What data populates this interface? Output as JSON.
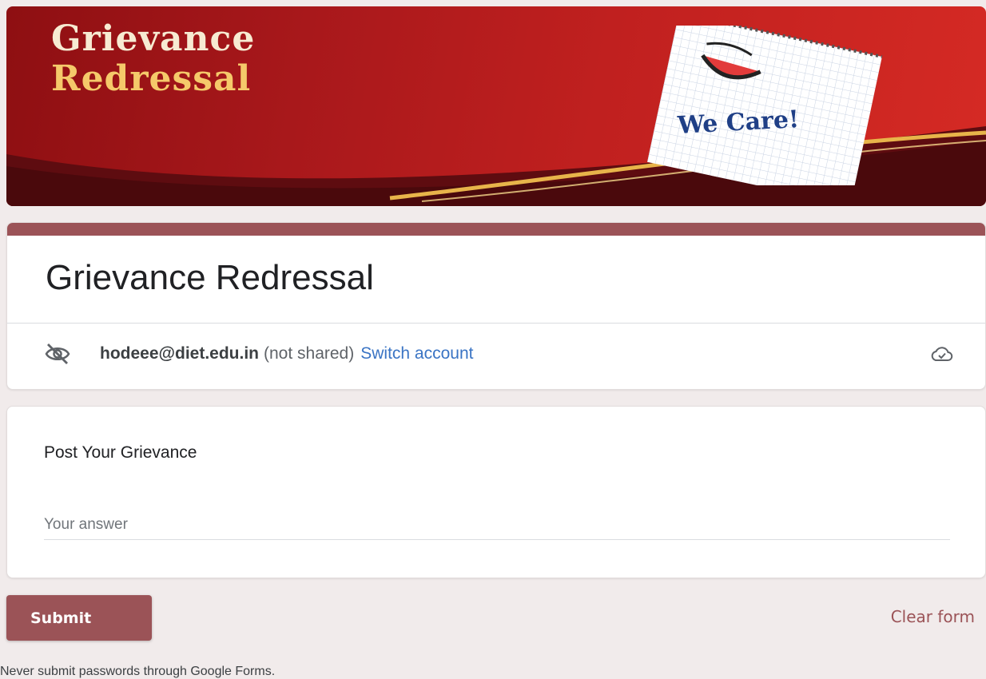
{
  "banner": {
    "title_line1": "Grievance",
    "title_line2": "Redressal",
    "note_text": "We Care!"
  },
  "form": {
    "title": "Grievance Redressal",
    "account": {
      "email": "hodeee@diet.edu.in",
      "not_shared": "(not shared)",
      "switch_label": "Switch account"
    },
    "question": {
      "label": "Post Your Grievance",
      "placeholder": "Your answer"
    },
    "submit_label": "Submit",
    "clear_label": "Clear form",
    "footer_note": "Never submit passwords through Google Forms."
  },
  "colors": {
    "theme": "#9b5357",
    "link": "#3a74c4",
    "page_bg": "#f1ebeb"
  },
  "icons": {
    "account_visibility": "eye-off-icon",
    "save_status": "cloud-check-icon"
  }
}
